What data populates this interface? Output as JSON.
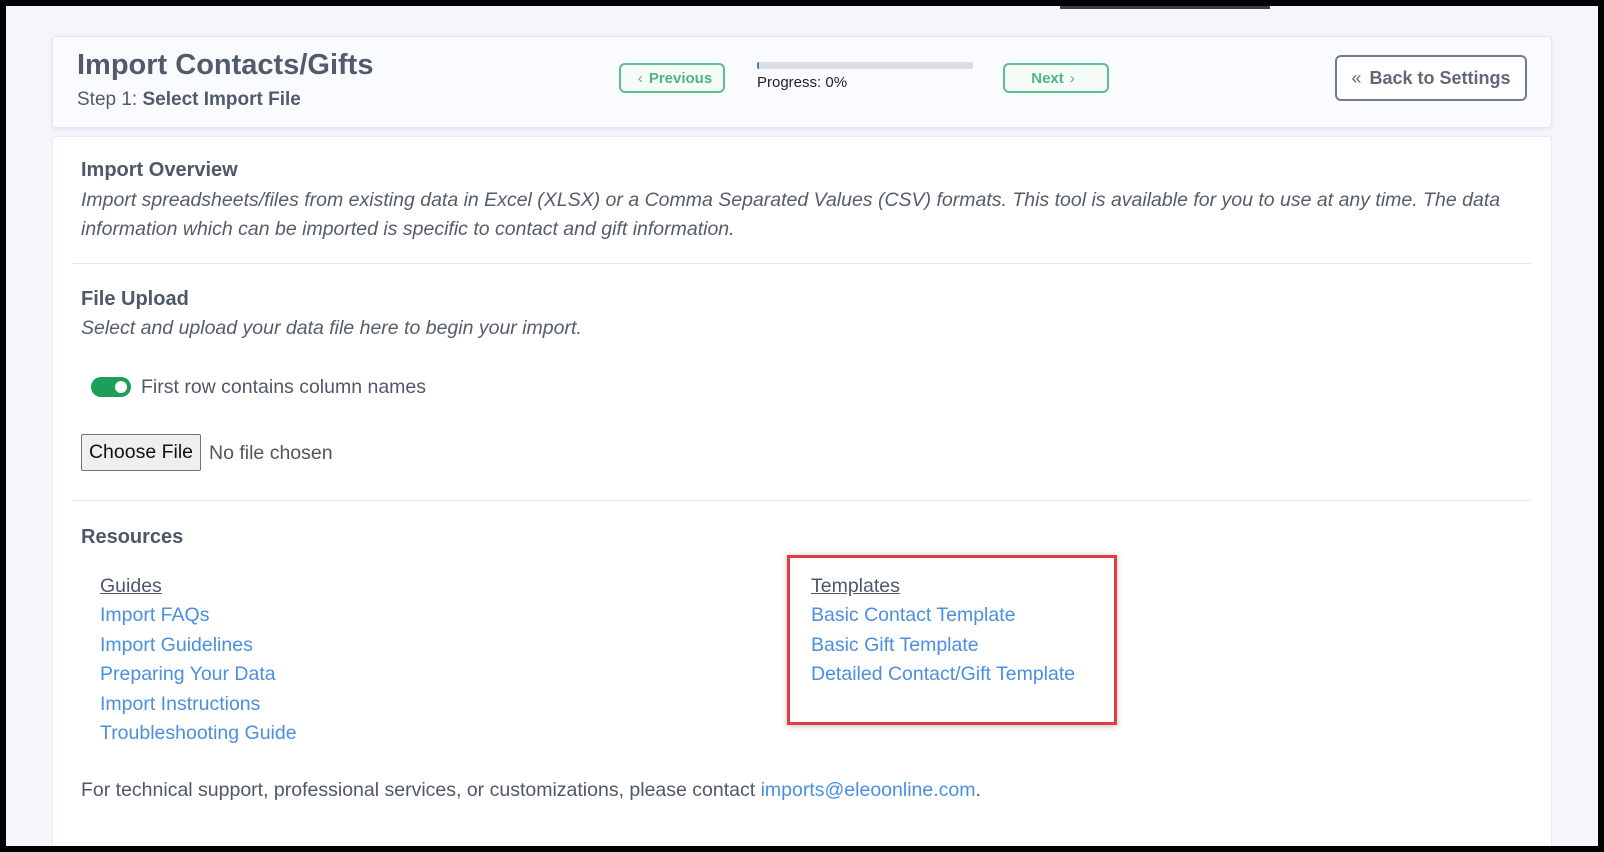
{
  "header": {
    "title": "Import Contacts/Gifts",
    "step_prefix": "Step 1:",
    "step_name": "Select Import File",
    "previous_label": "Previous",
    "next_label": "Next",
    "progress_label": "Progress: 0%",
    "progress_value": 0.01,
    "back_label": "Back to Settings"
  },
  "overview": {
    "title": "Import Overview",
    "line1": "Import spreadsheets/files from existing data in Excel (XLSX) or a Comma Separated Values (CSV) formats. This tool is available for you to use at any time. The data",
    "line2": "information which can be imported is specific to contact and gift information."
  },
  "upload": {
    "title": "File Upload",
    "description": "Select and upload your data file here to begin your import.",
    "toggle_label": "First row contains column names",
    "toggle_on": true,
    "choose_file_label": "Choose File",
    "no_file_text": "No file chosen"
  },
  "resources": {
    "title": "Resources",
    "guides_header": "Guides",
    "guides": [
      "Import FAQs",
      "Import Guidelines",
      "Preparing Your Data",
      "Import Instructions",
      "Troubleshooting Guide"
    ],
    "templates_header": "Templates",
    "templates": [
      "Basic Contact Template",
      "Basic Gift Template",
      "Detailed Contact/Gift Template"
    ]
  },
  "support": {
    "text": "For technical support, professional services, or customizations, please contact ",
    "email": "imports@eleoonline.com",
    "suffix": "."
  },
  "colors": {
    "accent_green": "#1e9e56",
    "link_blue": "#4a8fe0",
    "highlight_red": "#e33b40"
  }
}
